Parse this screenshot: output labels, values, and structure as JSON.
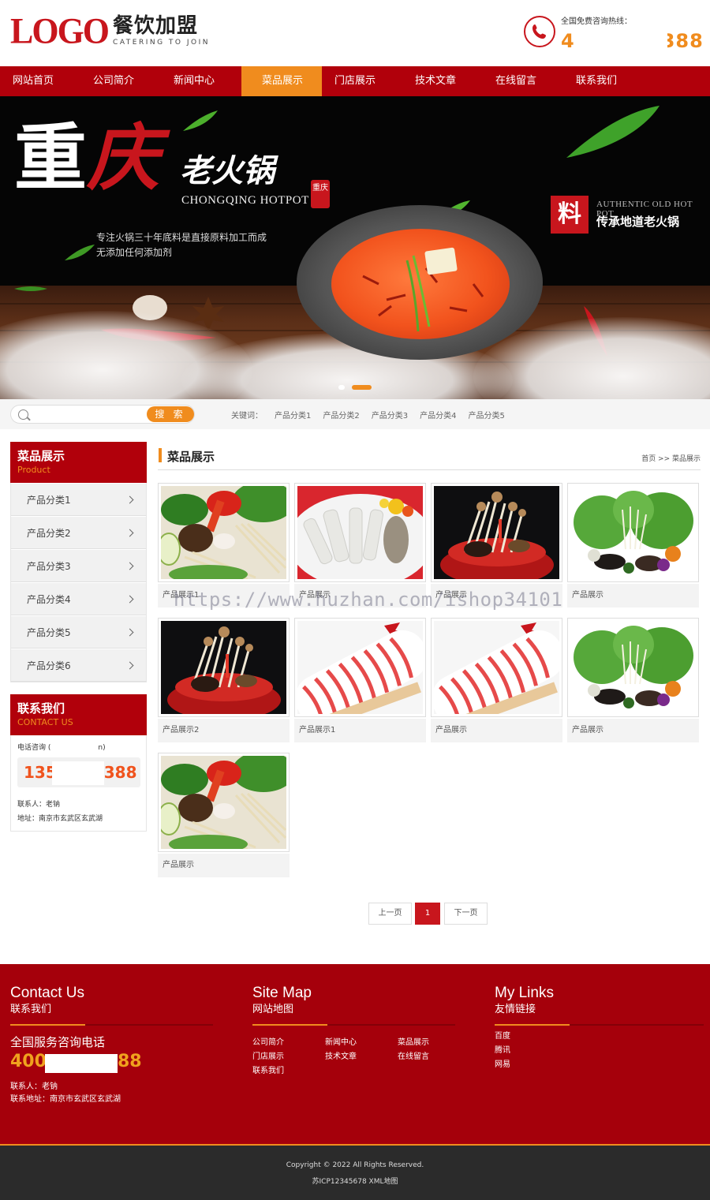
{
  "header": {
    "logo_mark": "LOGO",
    "logo_cn": "餐饮加盟",
    "logo_en": "CATERING TO JOIN",
    "hotline_label": "全国免费咨询热线：",
    "hotline_number": "4",
    "hotline_number_tail": "388"
  },
  "nav": {
    "items": [
      "网站首页",
      "公司简介",
      "新闻中心",
      "菜品展示",
      "门店展示",
      "技术文章",
      "在线留言",
      "联系我们"
    ],
    "active_index": 3
  },
  "banner": {
    "title_char1": "重",
    "title_char2": "庆",
    "title_rest": "老火锅",
    "title_en": "CHONGQING HOTPOT",
    "seal": "重庆",
    "slogan_line1": "专注火锅三十年底料是直接原料加工而成",
    "slogan_line2": "无添加任何添加剂",
    "badge": "料",
    "authentic_en": "AUTHENTIC OLD HOT POT",
    "authentic_cn": "传承地道老火锅"
  },
  "search": {
    "placeholder": "",
    "button": "搜 索",
    "keywords_label": "关键词：",
    "keywords": [
      "产品分类1",
      "产品分类2",
      "产品分类3",
      "产品分类4",
      "产品分类5"
    ]
  },
  "sidebar": {
    "products_title": "菜品展示",
    "products_en": "Product",
    "categories": [
      "产品分类1",
      "产品分类2",
      "产品分类3",
      "产品分类4",
      "产品分类5",
      "产品分类6"
    ],
    "contact_title": "联系我们",
    "contact_en": "CONTACT US",
    "phone_label": "电话咨询 (",
    "phone_label_tail": "n)",
    "phone_head": "135",
    "phone_tail": "388",
    "contact_person": "联系人：老钠",
    "address": "地址：南京市玄武区玄武湖"
  },
  "main": {
    "title": "菜品展示",
    "breadcrumb": "首页 >> 菜品展示",
    "products": [
      {
        "caption": "产品展示1",
        "art": "veggie-platter"
      },
      {
        "caption": "产品展示",
        "art": "white-mushroom"
      },
      {
        "caption": "产品展示",
        "art": "mushroom-bowl"
      },
      {
        "caption": "产品展示",
        "art": "green-salad"
      },
      {
        "caption": "产品展示2",
        "art": "mushroom-bowl"
      },
      {
        "caption": "产品展示1",
        "art": "lamb-rolls"
      },
      {
        "caption": "产品展示",
        "art": "lamb-rolls"
      },
      {
        "caption": "产品展示",
        "art": "green-salad"
      },
      {
        "caption": "产品展示",
        "art": "veggie-platter"
      }
    ],
    "watermark": "https://www.huzhan.com/ishop34101"
  },
  "pagination": {
    "prev": "上一页",
    "current": "1",
    "next": "下一页"
  },
  "footer": {
    "contact_en": "Contact Us",
    "contact_cn": "联系我们",
    "tel_label": "全国服务咨询电话",
    "tel_head": "400",
    "tel_tail": "88",
    "person": "联系人：老钠",
    "address": "联系地址：南京市玄武区玄武湖",
    "sitemap_en": "Site Map",
    "sitemap_cn": "网站地图",
    "sitemap_links": [
      "公司简介",
      "新闻中心",
      "菜品展示",
      "门店展示",
      "技术文章",
      "在线留言",
      "联系我们"
    ],
    "links_en": "My Links",
    "links_cn": "友情链接",
    "friend_links": [
      "百度",
      "腾讯",
      "网易"
    ],
    "copyright": "Copyright © 2022 All Rights Reserved.",
    "icp": "苏ICP12345678 XML地图"
  },
  "colors": {
    "primary_red": "#b1000b",
    "accent_orange": "#f08c1e",
    "footer_red": "#a5000b"
  }
}
